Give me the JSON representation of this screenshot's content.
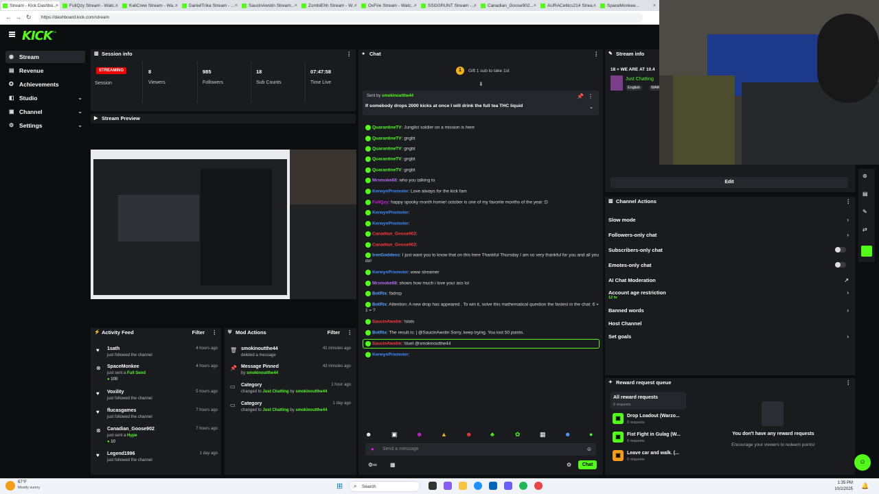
{
  "browser": {
    "tabs": [
      "Stream - Kick Dashbo...",
      "FuliQzy Stream - Watc...",
      "KaliCrew Stream - Wa...",
      "DanielTrika Stream - ...",
      "SaucinAwstin Stream...",
      "ZombiEhh Stream - W...",
      "OxFire Stream - Watc...",
      "SSGGRUNT Stream -...",
      "Canadian_Goose902...",
      "AURACeltics214 Strea...",
      "SpaceMonkee..."
    ],
    "url": "https://dashboard.kick.com/stream"
  },
  "brand": {
    "logo": "KICK",
    "beta": "BETA",
    "accent": "#53fc18"
  },
  "sidebar": {
    "items": [
      {
        "label": "Stream",
        "icon": "stream-icon"
      },
      {
        "label": "Revenue",
        "icon": "revenue-icon"
      },
      {
        "label": "Achievements",
        "icon": "trophy-icon"
      },
      {
        "label": "Studio",
        "icon": "studio-icon"
      },
      {
        "label": "Channel",
        "icon": "channel-icon"
      },
      {
        "label": "Settings",
        "icon": "gear-icon"
      }
    ]
  },
  "session": {
    "title": "Session info",
    "badge": "STREAMING",
    "session_label": "Session",
    "stats": [
      {
        "value": "8",
        "label": "Viewers"
      },
      {
        "value": "985",
        "label": "Followers"
      },
      {
        "value": "18",
        "label": "Sub Counts"
      },
      {
        "value": "07:47:58",
        "label": "Time Live"
      }
    ]
  },
  "preview": {
    "title": "Stream Preview"
  },
  "activity": {
    "title": "Activity Feed",
    "filter": "Filter",
    "items": [
      {
        "name": "1sath",
        "sub": "just followed the channel",
        "time": "4 hours ago",
        "icon": "heart-icon"
      },
      {
        "name": "SpaceMonkee",
        "sub": "just sent a",
        "gift": "Full Send",
        "amount": "100",
        "time": "4 hours ago",
        "icon": "kick-icon"
      },
      {
        "name": "Voxility",
        "sub": "just followed the channel",
        "time": "5 hours ago",
        "icon": "heart-icon"
      },
      {
        "name": "flucasgames",
        "sub": "just followed the channel",
        "time": "7 hours ago",
        "icon": "heart-icon"
      },
      {
        "name": "Canadian_Goose902",
        "sub": "just sent a",
        "gift": "Hype",
        "amount": "10",
        "time": "7 hours ago",
        "icon": "kick-icon"
      },
      {
        "name": "Legend1996",
        "sub": "just followed the channel",
        "time": "1 day ago",
        "icon": "heart-icon"
      }
    ]
  },
  "mod_actions": {
    "title": "Mod Actions",
    "filter": "Filter",
    "items": [
      {
        "name": "smokinoutthe44",
        "sub": "deleted a message",
        "time": "41 minutes ago",
        "icon": "trash-icon"
      },
      {
        "name": "Message Pinned",
        "sub_prefix": "by",
        "sub_user": "smokinoutthe44",
        "time": "43 minutes ago",
        "icon": "pin-icon"
      },
      {
        "name": "Category",
        "sub_prefix": "changed to",
        "cat": "Just Chatting",
        "by": "by",
        "sub_user": "smokinoutthe44",
        "time": "1 hour ago",
        "icon": "category-icon"
      },
      {
        "name": "Category",
        "sub_prefix": "changed to",
        "cat": "Just Chatting",
        "by": "by",
        "sub_user": "smokinoutthe44",
        "time": "1 day ago",
        "icon": "category-icon"
      }
    ]
  },
  "chat": {
    "title": "Chat",
    "gift_prompt": "Gift 1 sub to take 1st",
    "gift_rank": "1",
    "pinned_sent_by": "Sent by",
    "pinned_user": "smokinoutthe44",
    "pinned_text": "If somebody drops 2000 kicks at once I will drink the full tea THC liquid",
    "messages": [
      {
        "user": "QuarantineTV",
        "color": "#53fc18",
        "text": "Junglist soldier on a mission is here"
      },
      {
        "user": "QuarantineTV",
        "color": "#53fc18",
        "text": "gngbt"
      },
      {
        "user": "QuarantineTV",
        "color": "#53fc18",
        "text": "gngbt"
      },
      {
        "user": "QuarantineTV",
        "color": "#53fc18",
        "text": "gngbt"
      },
      {
        "user": "QuarantineTV",
        "color": "#53fc18",
        "text": "gngbt"
      },
      {
        "user": "Mrsmoke68",
        "color": "#b66ef5",
        "text": "who you talking to"
      },
      {
        "user": "KerwynPromoter",
        "color": "#3f8cff",
        "text": "Love always for the kick fam"
      },
      {
        "user": "FuliQzy",
        "color": "#d61cde",
        "text": "happy spooky month homie! october is one of my favorite months of the year :D"
      },
      {
        "user": "KerwynPromoter",
        "color": "#3f8cff",
        "text": ""
      },
      {
        "user": "KerwynPromoter",
        "color": "#3f8cff",
        "text": ""
      },
      {
        "user": "Canadian_Goose902",
        "color": "#ff3b3b",
        "text": ""
      },
      {
        "user": "Canadian_Goose902",
        "color": "#ff3b3b",
        "text": ""
      },
      {
        "user": "IronGoddess",
        "color": "#4fa3ff",
        "text": "I just want you to know that on this here Thankful Thursday I am so very thankful for you and all you do!"
      },
      {
        "user": "KerwynPromoter",
        "color": "#3f8cff",
        "text": "www streamer"
      },
      {
        "user": "Mrsmoke68",
        "color": "#b66ef5",
        "text": "shows how much i love your ass lol"
      },
      {
        "user": "BotRix",
        "color": "#53a7ff",
        "text": "!bdrop"
      },
      {
        "user": "BotRix",
        "color": "#53a7ff",
        "text": "Attention: A new drop has appeared . To win it, solve this mathematical question the fastest in the chat: 6 + 1 = ?"
      },
      {
        "user": "SaucinAwstin",
        "color": "#ff3b3b",
        "text": "!slots"
      },
      {
        "user": "BotRix",
        "color": "#53a7ff",
        "text": "The result is: | @SaucinAwstin Sorry, keep trying. You lost 50 points."
      },
      {
        "user": "SaucinAwstin",
        "color": "#ff3b3b",
        "text": "!duel @smokinoutthe44"
      },
      {
        "user": "KerwynPromoter",
        "color": "#3f8cff",
        "text": ""
      }
    ],
    "input_placeholder": "Send a message",
    "send_label": "Chat"
  },
  "stream_info": {
    "title": "Stream info",
    "stream_title": "18 + WE ARE AT 10.4",
    "category": "Just Chatting",
    "tags": [
      "English",
      "WAR"
    ],
    "edit_label": "Edit"
  },
  "channel_actions": {
    "title": "Channel Actions",
    "items": [
      {
        "label": "Slow mode",
        "kind": "chevron"
      },
      {
        "label": "Followers-only chat",
        "kind": "chevron"
      },
      {
        "label": "Subscribers-only chat",
        "kind": "toggle"
      },
      {
        "label": "Emotes-only chat",
        "kind": "toggle"
      },
      {
        "label": "AI Chat Moderation",
        "kind": "external"
      },
      {
        "label": "Account age restriction",
        "sub": "12 hr",
        "kind": "chevron"
      },
      {
        "label": "Banned words",
        "kind": "chevron"
      },
      {
        "label": "Host Channel",
        "kind": "none"
      },
      {
        "label": "Set goals",
        "kind": "chevron"
      }
    ]
  },
  "rewards": {
    "title": "Reward request queue",
    "all_label": "All reward requests",
    "all_sub": "0 requests",
    "items": [
      {
        "name": "Drop Loadout (Warzo...",
        "sub": "0 requests"
      },
      {
        "name": "Fist Fight in Gulag (W...",
        "sub": "0 requests"
      },
      {
        "name": "Leave car and walk. (...",
        "sub": "0 requests"
      }
    ],
    "empty_title": "You don't have any reward requests",
    "empty_sub": "Encourage your viewers to redeem points!"
  },
  "taskbar": {
    "weather_temp": "67°F",
    "weather_desc": "Mostly sunny",
    "search": "Search",
    "time": "1:35 PM",
    "date": "10/2/2025"
  }
}
